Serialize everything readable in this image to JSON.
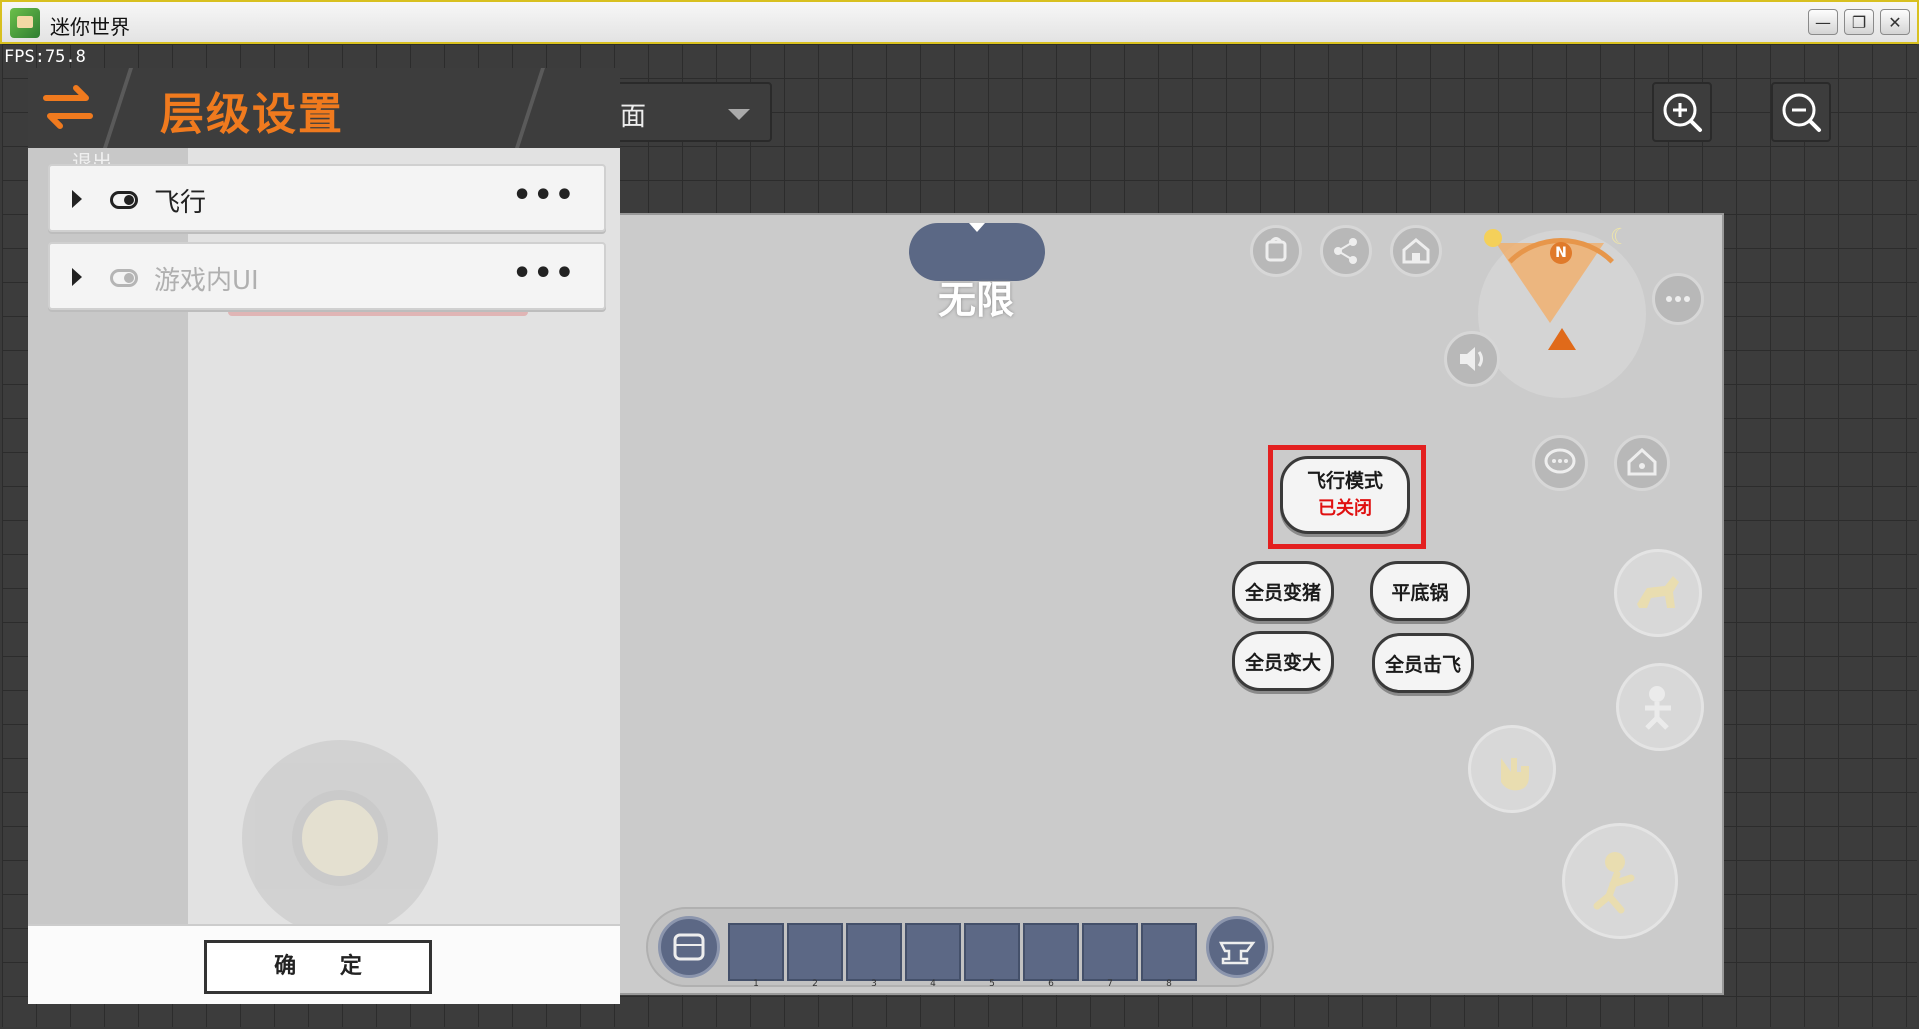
{
  "window": {
    "title": "迷你世界",
    "minimize": "—",
    "maximize": "❐",
    "close": "✕"
  },
  "fps_text": "FPS:75.8",
  "editor": {
    "layer_dropdown_text": "面",
    "zoom_in_icon": "zoom-in-icon",
    "zoom_out_icon": "zoom-out-icon"
  },
  "layer_panel": {
    "title": "层级设置",
    "ghost_text": "退出",
    "rows": [
      {
        "label": "飞行",
        "visible": true,
        "more": "•••"
      },
      {
        "label": "游戏内UI",
        "visible": false,
        "more": "•••"
      }
    ],
    "confirm_label": "确 定"
  },
  "game": {
    "mode_text": "无限",
    "fly_mode": {
      "label": "飞行模式",
      "status": "已关闭"
    },
    "buttons": [
      "全员变猪",
      "平底锅",
      "全员变大",
      "全员击飞"
    ],
    "compass_north": "N",
    "hotbar_slots": [
      "1",
      "2",
      "3",
      "4",
      "5",
      "6",
      "7",
      "8"
    ],
    "colors": {
      "accent": "#f07a1e",
      "highlight": "#e32020",
      "slot": "#5c6885"
    }
  }
}
